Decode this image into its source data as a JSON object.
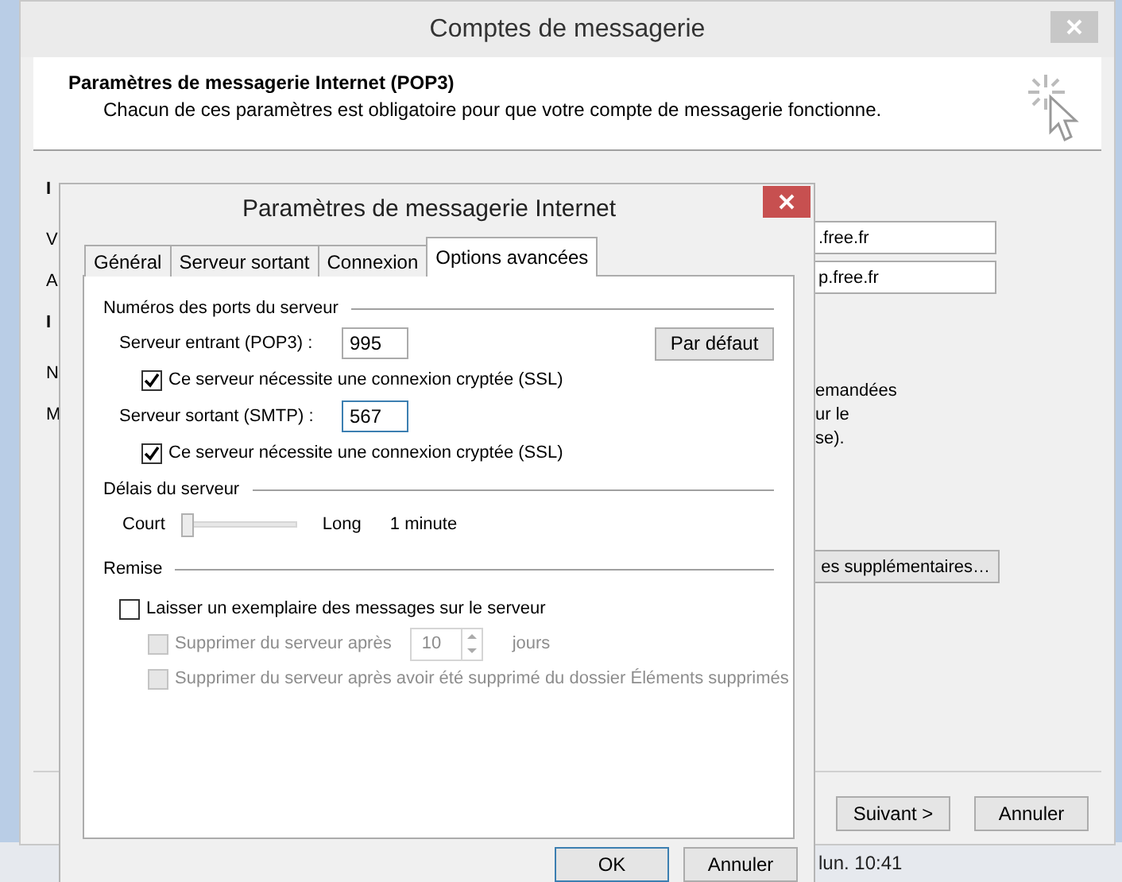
{
  "background_window": {
    "title": "Comptes de messagerie",
    "heading": "Paramètres de messagerie Internet (POP3)",
    "subheading": "Chacun de ces paramètres est obligatoire pour que votre compte de messagerie fonctionne.",
    "left_labels": [
      {
        "text": "I",
        "kind": "heading"
      },
      {
        "text": "V",
        "kind": "label"
      },
      {
        "text": "A",
        "kind": "label"
      },
      {
        "text": "I",
        "kind": "heading"
      },
      {
        "text": "N",
        "kind": "label"
      },
      {
        "text": "M",
        "kind": "label"
      }
    ],
    "fields": [
      ".free.fr",
      "p.free.fr"
    ],
    "note_lines": [
      "emandées",
      "ur le",
      "se)."
    ],
    "more_button": "es supplémentaires…",
    "buttons": [
      "Suivant >",
      "Annuler"
    ]
  },
  "taskbar": {
    "clock": "lun. 10:41"
  },
  "dialog": {
    "title": "Paramètres de messagerie Internet",
    "tabs": [
      {
        "label": "Général",
        "selected": false
      },
      {
        "label": "Serveur sortant",
        "selected": false
      },
      {
        "label": "Connexion",
        "selected": false
      },
      {
        "label": "Options avancées",
        "selected": true
      }
    ],
    "ports": {
      "title": "Numéros des ports du serveur",
      "default_button": "Par défaut",
      "rows": [
        {
          "label": "Serveur entrant (POP3) :",
          "value": "995",
          "focused": false,
          "ssl": {
            "label": "Ce serveur nécessite une connexion cryptée (SSL)",
            "checked": true
          }
        },
        {
          "label": "Serveur sortant (SMTP) :",
          "value": "567",
          "focused": true,
          "ssl": {
            "label": "Ce serveur nécessite une connexion cryptée (SSL)",
            "checked": true
          }
        }
      ]
    },
    "timeout": {
      "title": "Délais du serveur",
      "min_label": "Court",
      "max_label": "Long",
      "level": 0.05,
      "reading": "1 minute"
    },
    "delivery": {
      "title": "Remise",
      "leave": {
        "label": "Laisser un exemplaire des messages sur le serveur",
        "checked": false,
        "disabled": false
      },
      "delete_after": {
        "label": "Supprimer du serveur après",
        "checked": false,
        "disabled": true,
        "value": "10",
        "unit": "jours"
      },
      "delete_when": {
        "label": "Supprimer du serveur après avoir été supprimé du dossier Éléments supprimés",
        "checked": false,
        "disabled": true
      }
    },
    "buttons": [
      {
        "label": "OK",
        "default": true
      },
      {
        "label": "Annuler",
        "default": false
      }
    ]
  }
}
